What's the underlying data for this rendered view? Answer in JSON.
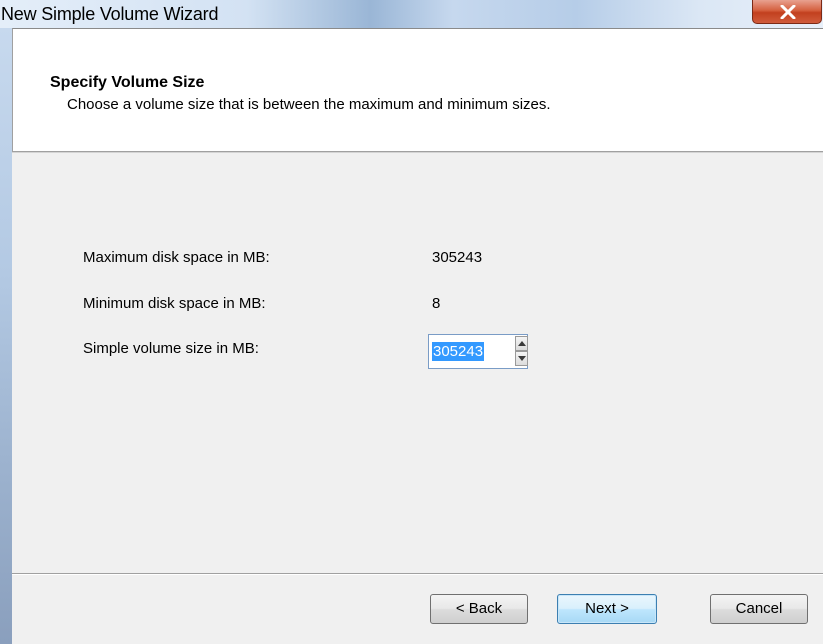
{
  "window": {
    "title": "New Simple Volume Wizard"
  },
  "header": {
    "title": "Specify Volume Size",
    "subtitle": "Choose a volume size that is between the maximum and minimum sizes."
  },
  "fields": {
    "max_label": "Maximum disk space in MB:",
    "max_value": "305243",
    "min_label": "Minimum disk space in MB:",
    "min_value": "8",
    "size_label": "Simple volume size in MB:",
    "size_value": "305243"
  },
  "buttons": {
    "back": "< Back",
    "next": "Next >",
    "cancel": "Cancel"
  },
  "icons": {
    "close": "close-icon",
    "spin_up": "arrow-up-icon",
    "spin_down": "arrow-down-icon"
  },
  "colors": {
    "close_button": "#c8452a",
    "selection": "#3399ff",
    "default_button_border": "#3c7fb1"
  }
}
